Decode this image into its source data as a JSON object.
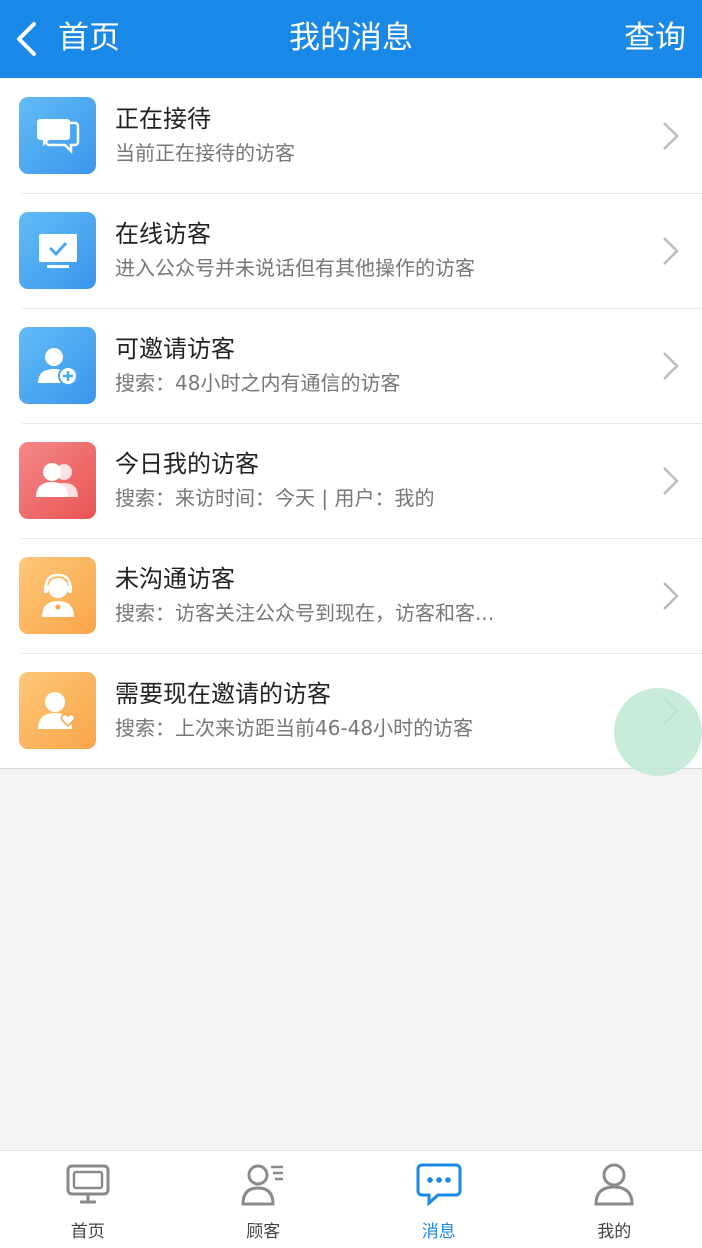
{
  "header": {
    "back_label": "首页",
    "title": "我的消息",
    "action_label": "查询"
  },
  "items": [
    {
      "title": "正在接待",
      "subtitle": "当前正在接待的访客",
      "icon": "chat-bubbles-icon",
      "color": "#4aa8f0"
    },
    {
      "title": "在线访客",
      "subtitle": "进入公众号并未说话但有其他操作的访客",
      "icon": "monitor-check-icon",
      "color": "#4aa8f0"
    },
    {
      "title": "可邀请访客",
      "subtitle": "搜索：48小时之内有通信的访客",
      "icon": "user-add-icon",
      "color": "#4aa8f0"
    },
    {
      "title": "今日我的访客",
      "subtitle": "搜索：来访时间：今天 | 用户：我的",
      "icon": "users-icon",
      "color": "#ee6464"
    },
    {
      "title": "未沟通访客",
      "subtitle": "搜索：访客关注公众号到现在，访客和客...",
      "icon": "agent-icon",
      "color": "#fbb35e"
    },
    {
      "title": "需要现在邀请的访客",
      "subtitle": "搜索：上次来访距当前46-48小时的访客",
      "icon": "user-heart-icon",
      "color": "#fbb35e"
    }
  ],
  "tabs": [
    {
      "label": "首页",
      "icon": "monitor-icon",
      "active": false
    },
    {
      "label": "顾客",
      "icon": "customer-list-icon",
      "active": false
    },
    {
      "label": "消息",
      "icon": "message-icon",
      "active": true
    },
    {
      "label": "我的",
      "icon": "person-icon",
      "active": false
    }
  ],
  "colors": {
    "primary": "#1a88e6",
    "background": "#f4f4f4"
  }
}
